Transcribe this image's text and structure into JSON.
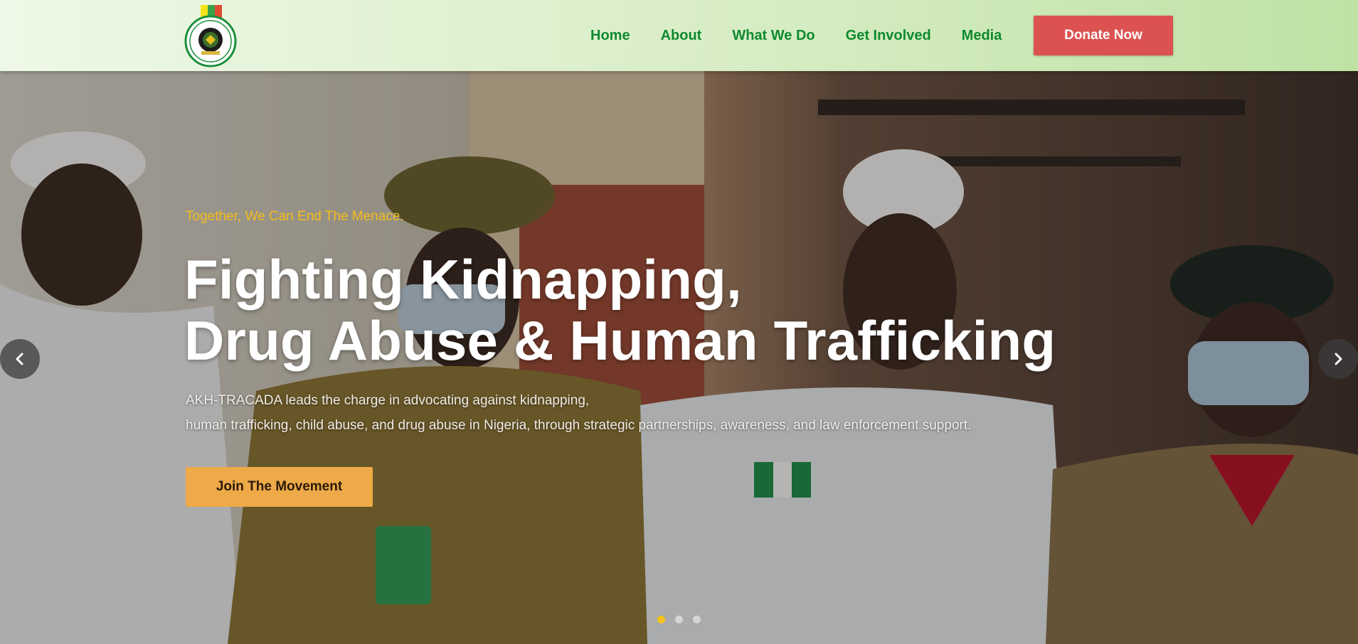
{
  "brand": {
    "logo_icon": "akh-tracada-seal-logo",
    "colors": {
      "green": "#0f8a2e",
      "red": "#dc5250",
      "gold": "#f4bd1b",
      "cta": "#eeaa48"
    }
  },
  "nav": {
    "items": [
      {
        "label": "Home"
      },
      {
        "label": "About"
      },
      {
        "label": "What We Do"
      },
      {
        "label": "Get Involved"
      },
      {
        "label": "Media"
      }
    ],
    "donate_label": "Donate Now"
  },
  "hero": {
    "eyebrow": "Together, We Can End The Menace.",
    "headline_line1": "Fighting Kidnapping,",
    "headline_line2": "Drug Abuse & Human Trafficking",
    "description_line1": "AKH-TRACADA leads the charge in advocating against kidnapping,",
    "description_line2": "human trafficking, child abuse, and drug abuse in Nigeria, through strategic partnerships, awareness, and law enforcement support.",
    "cta_label": "Join The Movement",
    "prev_icon": "chevron-left-icon",
    "next_icon": "chevron-right-icon",
    "slide_count": 3,
    "active_slide": 1
  }
}
